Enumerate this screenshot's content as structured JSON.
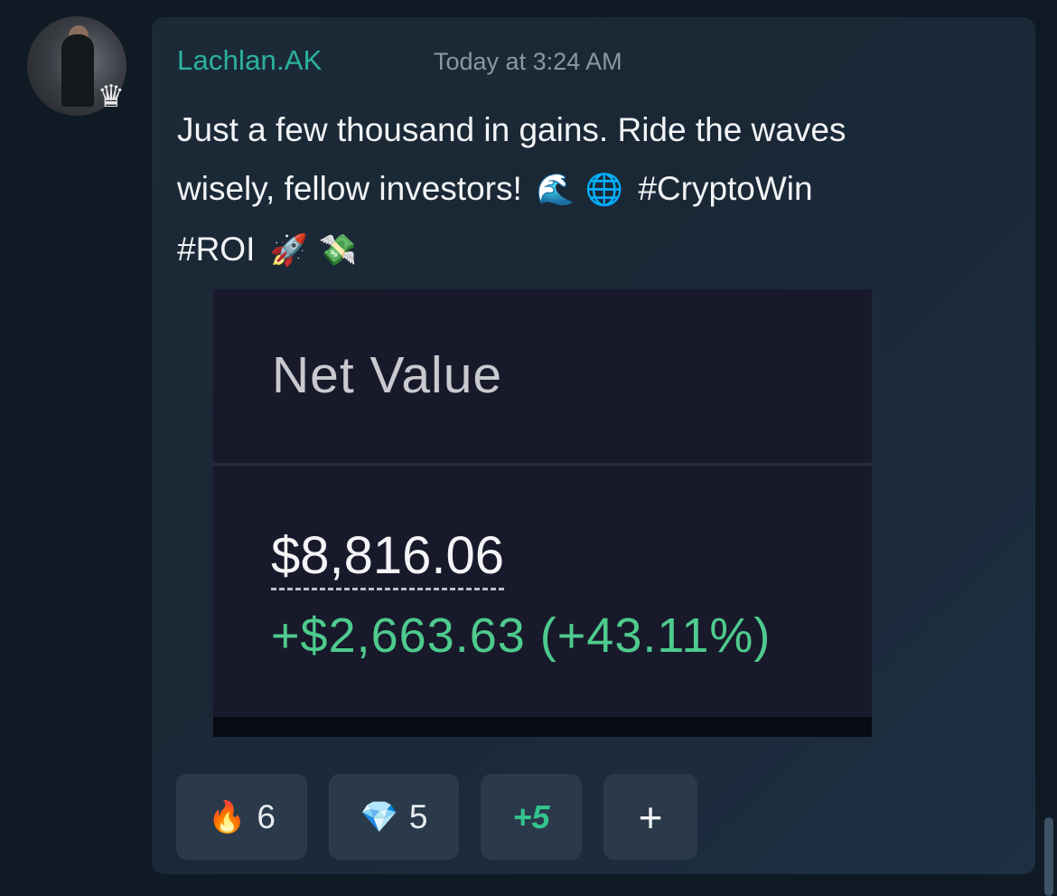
{
  "post": {
    "username": "Lachlan.AK",
    "timestamp": "Today at 3:24 AM",
    "message": {
      "line1": "Just a few thousand in gains. Ride the waves",
      "line2_text": "wisely, fellow investors!",
      "wave_emoji": "🌊",
      "globe_emoji": "🌐",
      "hashtag1": "#CryptoWin",
      "hashtag2": "#ROI",
      "rocket_emoji": "🚀",
      "money_emoji": "💸"
    },
    "avatar_badge": "♛"
  },
  "screenshot": {
    "label": "Net Value",
    "value": "$8,816.06",
    "change": "+$2,663.63 (+43.11%)"
  },
  "reactions": [
    {
      "emoji": "🔥",
      "count": "6"
    },
    {
      "emoji": "💎",
      "count": "5"
    }
  ],
  "more_reactions": "+5",
  "add_reaction": "+",
  "colors": {
    "username": "#2bb39a",
    "gain": "#4ecb8d",
    "card_bg": "#1c2a38"
  }
}
